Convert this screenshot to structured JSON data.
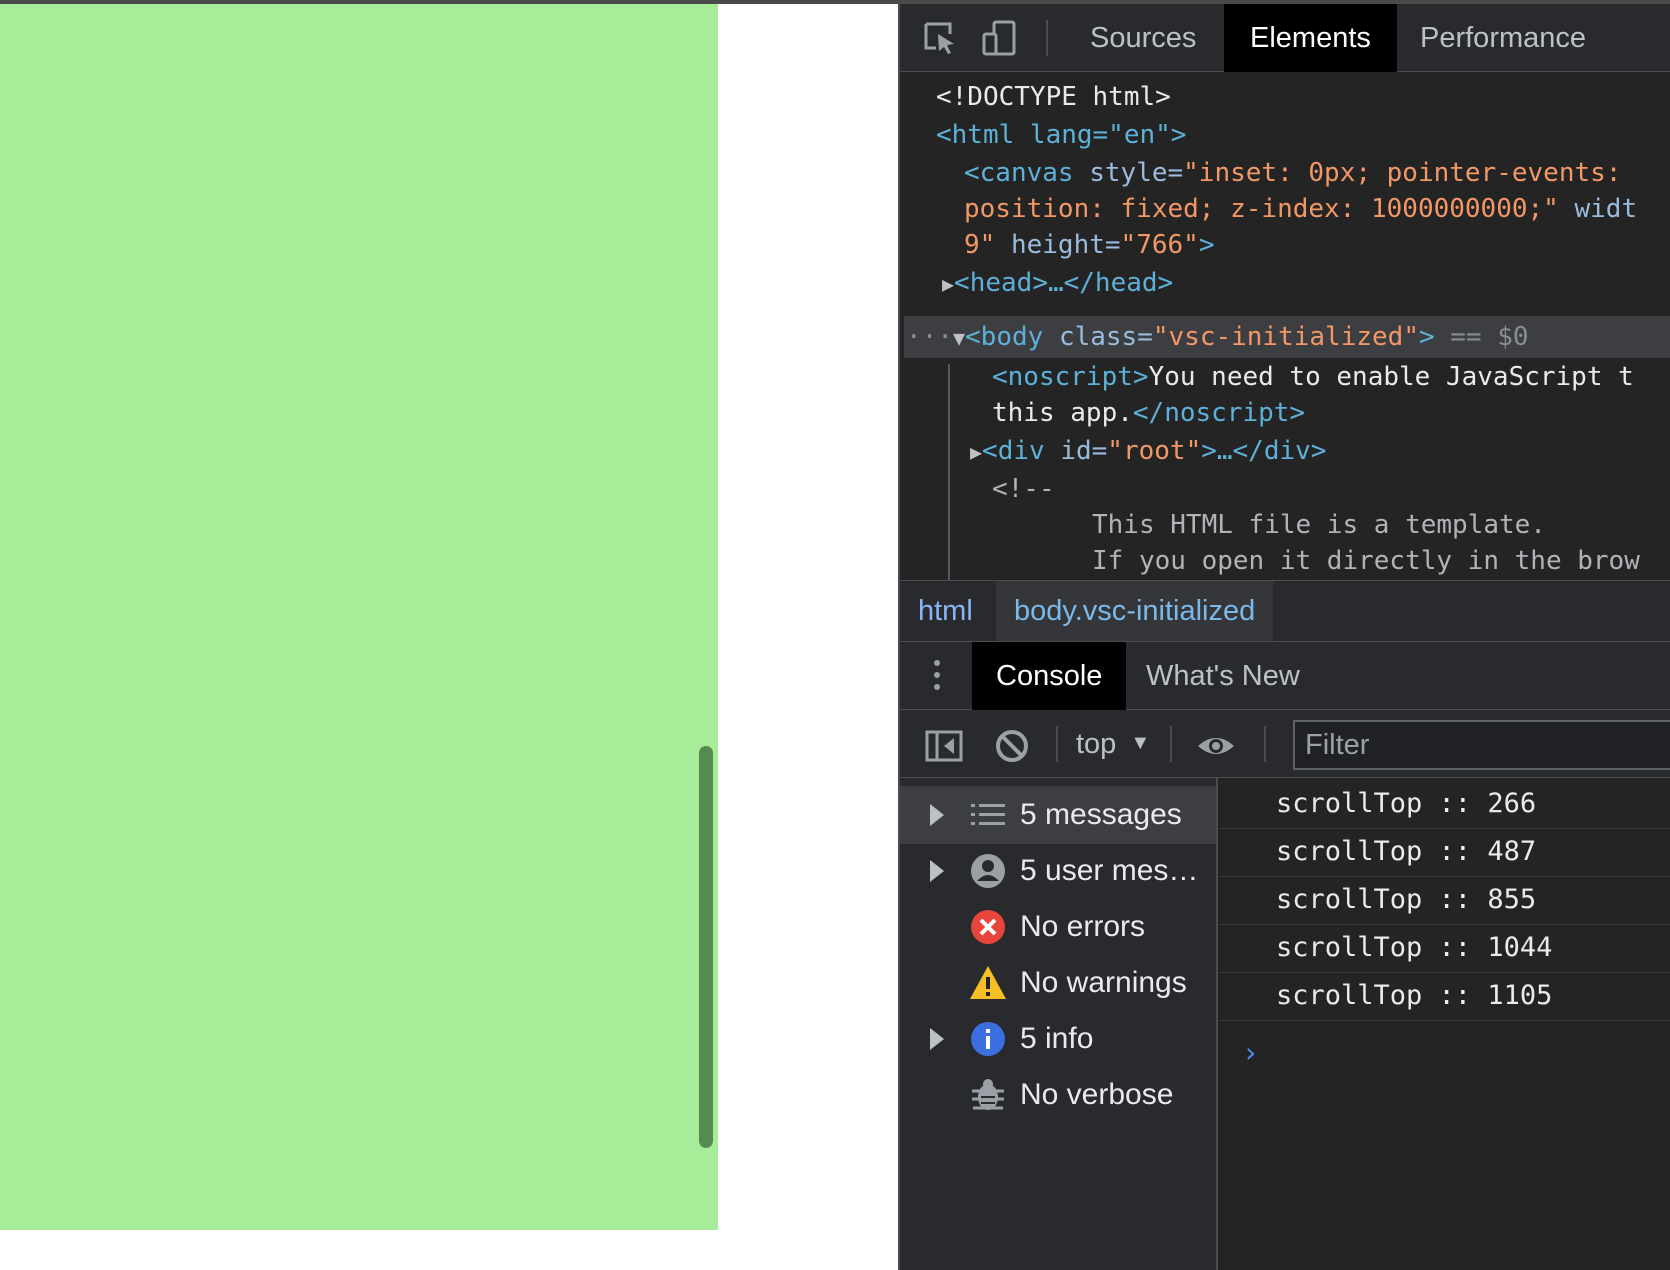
{
  "devtools": {
    "main_tabs": [
      "Sources",
      "Elements",
      "Performance"
    ],
    "active_tab": "Elements",
    "dom_lines": {
      "doctype": "<!DOCTYPE html>",
      "html_open": "<html lang=\"en\">",
      "canvas_1_tag": "<canvas ",
      "canvas_1_attr": "style=",
      "canvas_1_val": "\"inset: 0px; pointer-events: ",
      "canvas_2_val": "position: fixed; z-index: 1000000000;\"",
      "canvas_2_attr": " widt",
      "canvas_3_val": "9\"",
      "canvas_3_attr": " height=",
      "canvas_3_val2": "\"766\"",
      "canvas_3_tag": ">",
      "head": "<head>…</head>",
      "ellipsis": "···",
      "body_tag": "<body ",
      "body_attr": "class=",
      "body_val": "\"vsc-initialized\"",
      "body_close": ">",
      "body_eq": " == $0",
      "noscript_open": "<noscript>",
      "noscript_text_1": "You need to enable JavaScript t",
      "noscript_text_2": "this app.",
      "noscript_close": "</noscript>",
      "div_open": "<div ",
      "div_attr": "id=",
      "div_val": "\"root\"",
      "div_close": ">…</div>",
      "comment_open": "<!--",
      "comment_1": "This HTML file is a template.",
      "comment_2": "If you open it directly in the brow"
    },
    "breadcrumbs": [
      "html",
      "body.vsc-initialized"
    ],
    "drawer_tabs": [
      "Console",
      "What's New"
    ],
    "active_drawer_tab": "Console",
    "console_toolbar": {
      "context": "top",
      "filter_placeholder": "Filter"
    },
    "sidebar": [
      {
        "label": "5 messages",
        "icon": "list-icon",
        "expandable": true
      },
      {
        "label": "5 user mes…",
        "icon": "user-icon",
        "expandable": true
      },
      {
        "label": "No errors",
        "icon": "error-icon",
        "expandable": false
      },
      {
        "label": "No warnings",
        "icon": "warning-icon",
        "expandable": false
      },
      {
        "label": "5 info",
        "icon": "info-icon",
        "expandable": true
      },
      {
        "label": "No verbose",
        "icon": "bug-icon",
        "expandable": false
      }
    ],
    "log": [
      "scrollTop :: 266",
      "scrollTop :: 487",
      "scrollTop :: 855",
      "scrollTop :: 1044",
      "scrollTop :: 1105"
    ],
    "prompt": "›"
  },
  "colors": {
    "page_green": "#a7ec99",
    "scroll_thumb": "#578a51",
    "devtools_bg": "#242424"
  }
}
